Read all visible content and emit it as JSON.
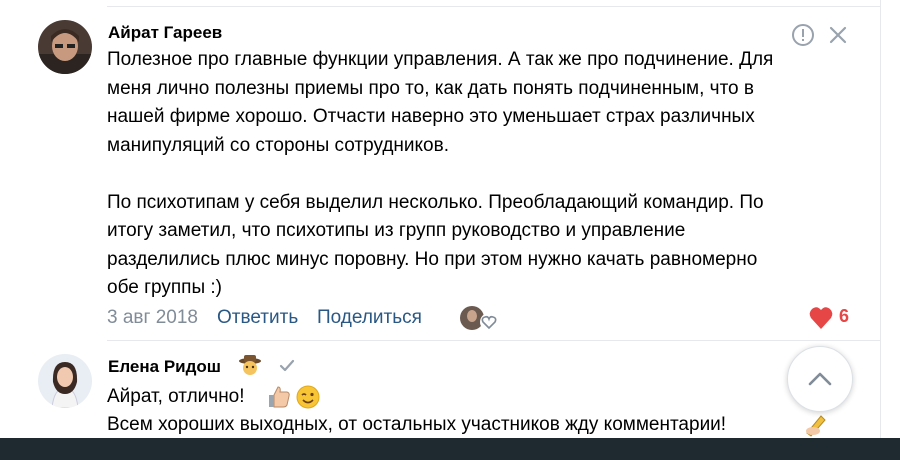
{
  "comments": [
    {
      "author": "Айрат Гареев",
      "text": "Полезное про главные функции управления. А так же про подчинение. Для\nменя лично полезны приемы про то, как дать понять подчиненным, что в\nнашей фирме хорошо. Отчасти наверно это уменьшает страх различных\nманипуляций со стороны сотрудников.\n\nПо психотипам у себя выделил несколько. Преобладающий командир. По\nитогу заметил, что психотипы из групп руководство и управление\nразделились плюс минус поровну. Но при этом нужно качать равномерно\nобе группы :)",
      "date": "3 авг 2018",
      "reply_label": "Ответить",
      "share_label": "Поделиться",
      "likes": "6"
    },
    {
      "author": "Елена Ридош",
      "line1": "Айрат, отлично!",
      "line2": "Всем хороших выходных, от остальных участников жду комментарии!"
    }
  ],
  "icons": [
    "report-icon",
    "close-icon",
    "heart-icon",
    "verified-icon",
    "chevron-up-icon",
    "thumbs-up-emoji",
    "wink-emoji",
    "writing-hand-emoji",
    "detective-emoji"
  ],
  "colors": {
    "link": "#2a5885",
    "muted": "#818c99",
    "like": "#e64646"
  }
}
